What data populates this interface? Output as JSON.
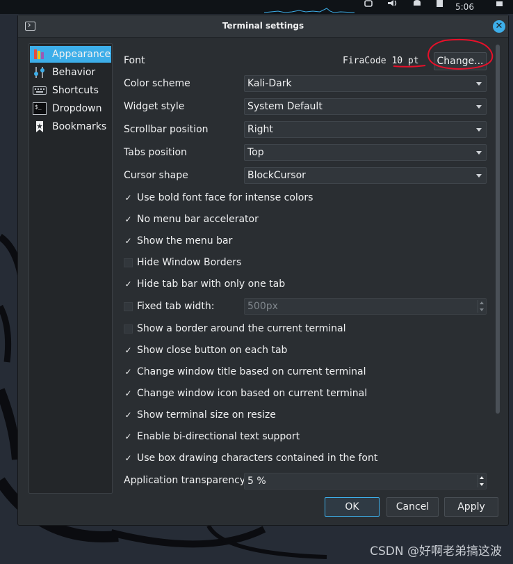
{
  "system": {
    "clock": "5:06"
  },
  "dialog": {
    "title": "Terminal settings",
    "sidebar": [
      {
        "label": "Appearance",
        "icon": "appearance-icon",
        "selected": true
      },
      {
        "label": "Behavior",
        "icon": "behavior-icon",
        "selected": false
      },
      {
        "label": "Shortcuts",
        "icon": "keyboard-icon",
        "selected": false
      },
      {
        "label": "Dropdown",
        "icon": "terminal-icon",
        "selected": false
      },
      {
        "label": "Bookmarks",
        "icon": "bookmark-icon",
        "selected": false
      }
    ],
    "font": {
      "label": "Font",
      "family": "FiraCode",
      "size": "10 pt",
      "change_label": "Change..."
    },
    "combos": {
      "color_scheme": {
        "label": "Color scheme",
        "value": "Kali-Dark"
      },
      "widget_style": {
        "label": "Widget style",
        "value": "System Default"
      },
      "scrollbar_position": {
        "label": "Scrollbar position",
        "value": "Right"
      },
      "tabs_position": {
        "label": "Tabs position",
        "value": "Top"
      },
      "cursor_shape": {
        "label": "Cursor shape",
        "value": "BlockCursor"
      }
    },
    "checks": [
      {
        "label": "Use bold font face for intense colors",
        "checked": true
      },
      {
        "label": "No menu bar accelerator",
        "checked": true
      },
      {
        "label": "Show the menu bar",
        "checked": true
      },
      {
        "label": "Hide Window Borders",
        "checked": false
      },
      {
        "label": "Hide tab bar with only one tab",
        "checked": true
      },
      {
        "label": "Fixed tab width:",
        "checked": false
      },
      {
        "label": "Show a border around the current terminal",
        "checked": false
      },
      {
        "label": "Show close button on each tab",
        "checked": true
      },
      {
        "label": "Change window title based on current terminal",
        "checked": true
      },
      {
        "label": "Change window icon based on current terminal",
        "checked": true
      },
      {
        "label": "Show terminal size on resize",
        "checked": true
      },
      {
        "label": "Enable bi-directional text support",
        "checked": true
      },
      {
        "label": "Use box drawing characters contained in the font",
        "checked": true
      }
    ],
    "fixed_tab_width": {
      "value": "500px"
    },
    "transparency": {
      "label": "Application transparency",
      "value": "5 %"
    },
    "buttons": {
      "ok": "OK",
      "cancel": "Cancel",
      "apply": "Apply"
    }
  },
  "watermark": "CSDN @好啊老弟搞这波",
  "colors": {
    "accent": "#3daee9",
    "window_bg": "#2a2e32",
    "annotation": "#e8102a"
  }
}
